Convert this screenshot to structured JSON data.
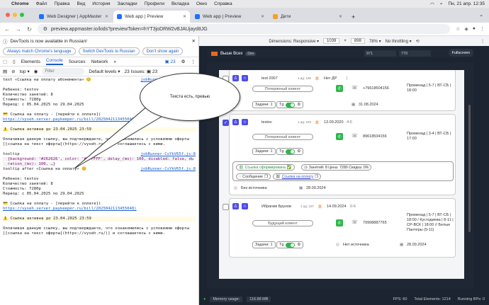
{
  "menubar": {
    "apple": "",
    "app": "Chrome",
    "items": [
      "Файл",
      "Правка",
      "Вид",
      "История",
      "Закладки",
      "Профили",
      "Вкладка",
      "Окно",
      "Справка"
    ],
    "clock": "Пн, 21 апр. 12:35"
  },
  "tabs": [
    {
      "label": "Web Designer | AppMaster",
      "color": "#1e6fff"
    },
    {
      "label": "Web app | Preview",
      "color": "#1e6fff"
    },
    {
      "label": "Web app | Preview",
      "color": "#1e6fff"
    },
    {
      "label": "Дети",
      "color": "#f0a030"
    }
  ],
  "address": {
    "url": "preview.appmaster.io/kids?previewToken=hYT3joDRW2vBJAUjayd8JG"
  },
  "devtools": {
    "info": "DevTools is now available in Russian!",
    "close": "✕",
    "buttons": [
      "Always match Chrome's language",
      "Switch DevTools to Russian",
      "Don't show again"
    ],
    "tabs": [
      "Elements",
      "Console",
      "Sources",
      "Network",
      "»"
    ],
    "issues_badge": "▣ 23",
    "filter_context": "top ▾",
    "filter_placeholder": "Filter",
    "levels": "Default levels ▾",
    "issues": "23 Issues: ▣ 23"
  },
  "console": [
    {
      "t": "text «Ссылка на оплату абонемента» 😊",
      "src": "jobRunner-CsYkV65f.js:8"
    },
    {
      "t": ""
    },
    {
      "t": "Ребенок: testov"
    },
    {
      "t": "Количество занятий: 8"
    },
    {
      "t": "Стоимость: 7280р"
    },
    {
      "t": "Период: с 05.04.2025 по 29.04.2025"
    },
    {
      "t": ""
    },
    {
      "t": "💳 Ссылка на оплату - [перейти к оплате]("
    },
    {
      "t": "https://vyseh.server.paykeeper.ru/bill/2025042113455048)",
      "link": true
    },
    {
      "t": ""
    },
    {
      "t": "⚠️ Ссылка активна до 23.04.2025 23:59",
      "warn": true
    },
    {
      "t": ""
    },
    {
      "t": "Оплачивая данную ссылку, вы подтверждаете, что ознакомились с условиями оферты"
    },
    {
      "t": "[[ссылка на текст оферты](https://vyseh.ru/)] и соглашаетесь с ними."
    },
    {
      "t": ""
    },
    {
      "t": "tooltip",
      "src": "jobRunner-CsYkV65f.js:8"
    },
    {
      "t": "  {background: '#262626', color: '#FFFFFF', delay_(ms): 100, disabled: false, du",
      "code": true
    },
    {
      "t": "  ration_(ms): 100, …}",
      "code": true
    },
    {
      "t": "tooltip after «Ссылка на оплату» 😊",
      "src": "jobRunner-CsYkV65f.js:8"
    },
    {
      "t": ""
    },
    {
      "t": "Ребенок: testov"
    },
    {
      "t": "Количество занятий: 8"
    },
    {
      "t": "Стоимость: 7280р"
    },
    {
      "t": "Период: с 05.04.2025 по 29.04.2025"
    },
    {
      "t": ""
    },
    {
      "t": "💳 Ссылка на оплату - [перейти к оплате]("
    },
    {
      "t": "https://vyseh.server.paykeeper.ru/bill/2025042113455048)",
      "link": true
    },
    {
      "t": ""
    },
    {
      "t": "⚠️ Ссылка активна до 23.04.2025 23:59",
      "warn": true
    },
    {
      "t": ""
    },
    {
      "t": "Оплачивая данную ссылку, вы подтверждаете, что ознакомились с условиями оферты"
    },
    {
      "t": "[[ссылка на текст оферты](https://vyseh.ru/)] и соглашаетесь с ними."
    }
  ],
  "bubble": {
    "text": "Текста есть, превью"
  },
  "preview": {
    "dimensions_label": "Dimensions: Responsive ▾",
    "width": "1039",
    "height": "898",
    "zoom": "78% ▾",
    "throttle": "No throttling ▾",
    "app_name": "Выше Всех",
    "app_tag": "Dev",
    "w_box": "971",
    "h_box": "770",
    "fullscreen": "Fullscreen"
  },
  "cards": [
    {
      "name": "test 2007",
      "id": "1 ид: 105",
      "birth": "Нет ДР",
      "age": "|",
      "status": "Потерянный клиент",
      "phone": "+79618504156",
      "address": "Променад | 5-7 | ВТ-СБ | 18:00",
      "date": "31.08.2024",
      "tasks": "Задачи: 1",
      "tg": "Tg"
    },
    {
      "name": "testov",
      "id": "1 ид: 103",
      "birth": "13.09.2020",
      "age": "4-6",
      "status": "Потерянный клиент",
      "phone": "89618504156",
      "address": "Променад | 3-4 | ВТ-СБ | 17:00",
      "tasks": "Задачи: 1",
      "tg": "Tg",
      "chip_link": "Ссылка сформирована",
      "chip_info": "Занятий: 8 Цена: 7280 Скидка: 0%",
      "chip_msg": "Сообщение",
      "chip_pay": "Ссылка на оплату",
      "source": "Без источника",
      "date": "28.09.2024"
    },
    {
      "name": "Ибрагим Брунов",
      "id": "1 ид: 107",
      "birth": "14.09.2024",
      "age": "0-6",
      "status": "Будущий клиент",
      "phone": "79998887765",
      "address": "Променад | 5-7 | ВТ-СБ | 18:00 / Кустодиева | 8-11 | СР-ВСК | 18:00 // Белые Пантеры (9-11)",
      "tasks": "Задачи: 1",
      "tg": "Tg",
      "source": "Нет источника",
      "date": "28.09.2024"
    }
  ],
  "footer": {
    "memory_label": "Memory usage:",
    "memory": "116.88 MB",
    "fps_label": "FPS:",
    "fps": "60",
    "elements": "Total Elements: 1214",
    "bps": "Running BPs: 0"
  }
}
